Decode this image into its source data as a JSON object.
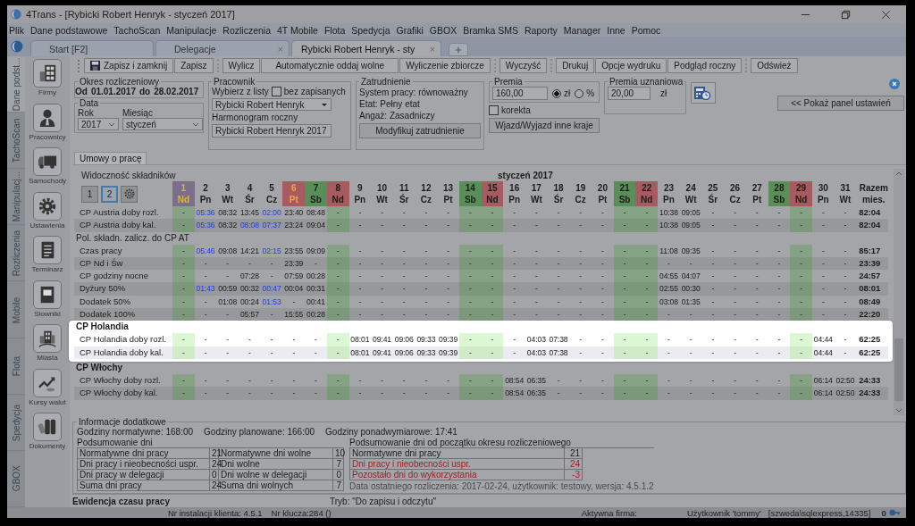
{
  "window": {
    "title": "4Trans - [Rybicki Robert Henryk - styczeń 2017]"
  },
  "menu": [
    "Plik",
    "Dane podstawowe",
    "TachoScan",
    "Manipulacje",
    "Rozliczenia",
    "4T Mobile",
    "Flota",
    "Spedycja",
    "Grafiki",
    "GBOX",
    "Bramka SMS",
    "Raporty",
    "Manager",
    "Inne",
    "Pomoc"
  ],
  "tabs": [
    {
      "label": "Start [F2]",
      "selected": false
    },
    {
      "label": "Delegacje",
      "close": "×",
      "selected": false
    },
    {
      "label": "Rybicki Robert Henryk - sty",
      "close": "×",
      "selected": true
    }
  ],
  "side_tabs": [
    {
      "label": "Dane podst...",
      "selected": true
    },
    {
      "label": "TachoScan",
      "selected": false
    },
    {
      "label": "Manipulacj...",
      "selected": false
    },
    {
      "label": "Rozliczenia",
      "selected": false
    },
    {
      "label": "Mobile",
      "selected": false
    },
    {
      "label": "Flota",
      "selected": false
    },
    {
      "label": "Spedycja",
      "selected": false
    },
    {
      "label": "GBOX",
      "selected": false
    }
  ],
  "sidebar": [
    {
      "label": "Firmy"
    },
    {
      "label": "Pracownicy"
    },
    {
      "label": "Samochody"
    },
    {
      "label": "Ustawienia"
    },
    {
      "label": "Terminarz"
    },
    {
      "label": "Słowniki"
    },
    {
      "label": "Miasta"
    },
    {
      "label": "Kursy walut"
    },
    {
      "label": "Dokumenty"
    }
  ],
  "toolbar": [
    [
      "Zapisz i zamknij",
      "Zapisz"
    ],
    [
      "Wylicz",
      "Automatycznie oddaj wolne",
      "Wyliczenie zbiorcze"
    ],
    [
      "Wyczyść"
    ],
    [
      "Drukuj",
      "Opcje wydruku",
      "Podgląd roczny"
    ],
    [
      "Odśwież"
    ]
  ],
  "period": {
    "title": "Okres rozliczeniowy",
    "from_label": "Od",
    "from": "01.01.2017",
    "to_label": "do",
    "to": "28.02.2017"
  },
  "date": {
    "title": "Data",
    "year_label": "Rok",
    "year": "2017",
    "month_label": "Miesiąc",
    "month": "styczeń"
  },
  "employee": {
    "title": "Pracownik",
    "choose_label": "Wybierz z listy",
    "unsaved_label": "bez zapisanych",
    "unsaved_checked": false,
    "employee": "Rybicki Robert Henryk",
    "schedule_label": "Harmonogram roczny",
    "schedule": "Rybicki Robert Henryk 2017"
  },
  "employment": {
    "title": "Zatrudnienie",
    "lines": [
      "System pracy: równoważny",
      "Etat: Pełny etat",
      "Angaż: Zasadniczy"
    ],
    "button": "Modyfikuj zatrudnienie"
  },
  "bonus": {
    "title": "Premia",
    "value": "160,00",
    "units": [
      {
        "label": "zł",
        "selected": true
      },
      {
        "label": "%",
        "selected": false
      }
    ],
    "correction_label": "korekta",
    "correction_checked": false,
    "button": "Wjazd/Wyjazd inne kraje"
  },
  "discretionary_bonus": {
    "title": "Premia uznaniowa",
    "value": "20,00",
    "unit": "zł"
  },
  "settings_button": "<< Pokaż panel ustawień",
  "content_tabs": [
    {
      "label": "Umowy o pracę",
      "selected": true
    }
  ],
  "grid": {
    "visibility_label": "Widoczność składników",
    "visibility_buttons": [
      {
        "label": "1",
        "selected": false
      },
      {
        "label": "2",
        "selected": true
      }
    ],
    "month": "styczeń 2017",
    "total_label": "Razem mies.",
    "days": [
      {
        "number": "1",
        "weekday": "Nd",
        "kind": "feast_sunday",
        "rest": true
      },
      {
        "number": "2",
        "weekday": "Pn",
        "kind": "workday",
        "rest": false
      },
      {
        "number": "3",
        "weekday": "Wt",
        "kind": "workday",
        "rest": false
      },
      {
        "number": "4",
        "weekday": "Śr",
        "kind": "workday",
        "rest": false
      },
      {
        "number": "5",
        "weekday": "Cz",
        "kind": "workday",
        "rest": false
      },
      {
        "number": "6",
        "weekday": "Pt",
        "kind": "feast",
        "rest": false
      },
      {
        "number": "7",
        "weekday": "Sb",
        "kind": "saturday",
        "rest": false
      },
      {
        "number": "8",
        "weekday": "Nd",
        "kind": "sunday",
        "rest": true
      },
      {
        "number": "9",
        "weekday": "Pn",
        "kind": "workday",
        "rest": false
      },
      {
        "number": "10",
        "weekday": "Wt",
        "kind": "workday",
        "rest": false
      },
      {
        "number": "11",
        "weekday": "Śr",
        "kind": "workday",
        "rest": false
      },
      {
        "number": "12",
        "weekday": "Cz",
        "kind": "workday",
        "rest": false
      },
      {
        "number": "13",
        "weekday": "Pt",
        "kind": "workday",
        "rest": false
      },
      {
        "number": "14",
        "weekday": "Sb",
        "kind": "saturday",
        "rest": true
      },
      {
        "number": "15",
        "weekday": "Nd",
        "kind": "sunday",
        "rest": true
      },
      {
        "number": "16",
        "weekday": "Pn",
        "kind": "workday",
        "rest": false
      },
      {
        "number": "17",
        "weekday": "Wt",
        "kind": "workday",
        "rest": false
      },
      {
        "number": "18",
        "weekday": "Śr",
        "kind": "workday",
        "rest": false
      },
      {
        "number": "19",
        "weekday": "Cz",
        "kind": "workday",
        "rest": false
      },
      {
        "number": "20",
        "weekday": "Pt",
        "kind": "workday",
        "rest": false
      },
      {
        "number": "21",
        "weekday": "Sb",
        "kind": "saturday",
        "rest": true
      },
      {
        "number": "22",
        "weekday": "Nd",
        "kind": "sunday",
        "rest": true
      },
      {
        "number": "23",
        "weekday": "Pn",
        "kind": "workday",
        "rest": false
      },
      {
        "number": "24",
        "weekday": "Wt",
        "kind": "workday",
        "rest": false
      },
      {
        "number": "25",
        "weekday": "Śr",
        "kind": "workday",
        "rest": false
      },
      {
        "number": "26",
        "weekday": "Cz",
        "kind": "workday",
        "rest": false
      },
      {
        "number": "27",
        "weekday": "Pt",
        "kind": "workday",
        "rest": false
      },
      {
        "number": "28",
        "weekday": "Sb",
        "kind": "saturday",
        "rest": false
      },
      {
        "number": "29",
        "weekday": "Nd",
        "kind": "sunday",
        "rest": true
      },
      {
        "number": "30",
        "weekday": "Pn",
        "kind": "workday",
        "rest": false
      },
      {
        "number": "31",
        "weekday": "Wt",
        "kind": "workday",
        "rest": false
      }
    ],
    "groups": [
      {
        "highlighted": false,
        "rows": [
          {
            "label": "CP Austria doby rozl.",
            "blue": [
              false,
              true,
              false,
              false,
              true,
              false,
              false,
              false,
              false,
              false,
              false,
              false,
              false,
              false,
              false,
              false,
              false,
              false,
              false,
              false,
              false,
              false,
              false,
              false,
              false,
              false,
              false,
              false,
              false,
              false,
              false
            ],
            "values": [
              "-",
              "05:36",
              "08:32",
              "13:45",
              "02:00",
              "23:40",
              "08:48",
              "-",
              "-",
              "-",
              "-",
              "-",
              "-",
              "-",
              "-",
              "-",
              "-",
              "-",
              "-",
              "-",
              "-",
              "-",
              "10:38",
              "09:05",
              "-",
              "-",
              "-",
              "-",
              "-",
              "-",
              "-",
              "82:04"
            ]
          },
          {
            "label": "CP Austria doby kal.",
            "blue": [
              false,
              true,
              false,
              true,
              true,
              false,
              false,
              false,
              false,
              false,
              false,
              false,
              false,
              false,
              false,
              false,
              false,
              false,
              false,
              false,
              false,
              false,
              false,
              false,
              false,
              false,
              false,
              false,
              false,
              false,
              false
            ],
            "values": [
              "-",
              "05:36",
              "08:32",
              "08:08",
              "07:37",
              "23:24",
              "09:04",
              "-",
              "-",
              "-",
              "-",
              "-",
              "-",
              "-",
              "-",
              "-",
              "-",
              "-",
              "-",
              "-",
              "-",
              "-",
              "10:38",
              "09:05",
              "-",
              "-",
              "-",
              "-",
              "-",
              "-",
              "-",
              "82:04"
            ]
          }
        ]
      },
      {
        "label": "Pol. składn. zalicz. do CP AT",
        "kind": "note",
        "highlighted": false,
        "rows": [
          {
            "label": "Czas pracy",
            "blue": [
              false,
              true,
              false,
              false,
              true,
              false,
              false,
              false,
              false,
              false,
              false,
              false,
              false,
              false,
              false,
              false,
              false,
              false,
              false,
              false,
              false,
              false,
              false,
              false,
              false,
              false,
              false,
              false,
              false,
              false,
              false
            ],
            "values": [
              "-",
              "05:46",
              "09:08",
              "14:21",
              "02:15",
              "23:55",
              "09:09",
              "-",
              "-",
              "-",
              "-",
              "-",
              "-",
              "-",
              "-",
              "-",
              "-",
              "-",
              "-",
              "-",
              "-",
              "-",
              "11:08",
              "09:35",
              "-",
              "-",
              "-",
              "-",
              "-",
              "-",
              "-",
              "85:17"
            ]
          },
          {
            "label": "CP Nd i Św",
            "values": [
              "-",
              "-",
              "-",
              "-",
              "-",
              "23:39",
              "-",
              "-",
              "-",
              "-",
              "-",
              "-",
              "-",
              "-",
              "-",
              "-",
              "-",
              "-",
              "-",
              "-",
              "-",
              "-",
              "-",
              "-",
              "-",
              "-",
              "-",
              "-",
              "-",
              "-",
              "-",
              "23:39"
            ]
          },
          {
            "label": "CP godziny nocne",
            "values": [
              "-",
              "-",
              "-",
              "07:28",
              "-",
              "07:59",
              "00:28",
              "-",
              "-",
              "-",
              "-",
              "-",
              "-",
              "-",
              "-",
              "-",
              "-",
              "-",
              "-",
              "-",
              "-",
              "-",
              "04:55",
              "04:07",
              "-",
              "-",
              "-",
              "-",
              "-",
              "-",
              "-",
              "24:57"
            ]
          },
          {
            "label": "Dyżury 50%",
            "blue": [
              false,
              true,
              false,
              false,
              true,
              false,
              false,
              false,
              false,
              false,
              false,
              false,
              false,
              false,
              false,
              false,
              false,
              false,
              false,
              false,
              false,
              false,
              false,
              false,
              false,
              false,
              false,
              false,
              false,
              false,
              false
            ],
            "values": [
              "-",
              "01:43",
              "00:59",
              "00:32",
              "00:47",
              "00:04",
              "00:31",
              "-",
              "-",
              "-",
              "-",
              "-",
              "-",
              "-",
              "-",
              "-",
              "-",
              "-",
              "-",
              "-",
              "-",
              "-",
              "02:55",
              "00:30",
              "-",
              "-",
              "-",
              "-",
              "-",
              "-",
              "-",
              "08:01"
            ]
          },
          {
            "label": "Dodatek 50%",
            "blue": [
              false,
              false,
              false,
              false,
              true,
              false,
              false,
              false,
              false,
              false,
              false,
              false,
              false,
              false,
              false,
              false,
              false,
              false,
              false,
              false,
              false,
              false,
              false,
              false,
              false,
              false,
              false,
              false,
              false,
              false,
              false
            ],
            "values": [
              "-",
              "-",
              "01:08",
              "00:24",
              "01:53",
              "-",
              "00:41",
              "-",
              "-",
              "-",
              "-",
              "-",
              "-",
              "-",
              "-",
              "-",
              "-",
              "-",
              "-",
              "-",
              "-",
              "-",
              "03:08",
              "01:35",
              "-",
              "-",
              "-",
              "-",
              "-",
              "-",
              "-",
              "08:49"
            ]
          },
          {
            "label": "Dodatek 100%",
            "values": [
              "-",
              "-",
              "-",
              "05:57",
              "-",
              "15:55",
              "00:28",
              "-",
              "-",
              "-",
              "-",
              "-",
              "-",
              "-",
              "-",
              "-",
              "-",
              "-",
              "-",
              "-",
              "-",
              "-",
              "-",
              "-",
              "-",
              "-",
              "-",
              "-",
              "-",
              "-",
              "-",
              "22:20"
            ]
          }
        ]
      },
      {
        "label": "CP Holandia",
        "kind": "section",
        "highlighted": true,
        "rows": [
          {
            "label": "CP Holandia doby rozl.",
            "values": [
              "-",
              "-",
              "-",
              "-",
              "-",
              "-",
              "-",
              "-",
              "08:01",
              "09:41",
              "09:06",
              "09:33",
              "09:39",
              "-",
              "-",
              "-",
              "04:03",
              "07:38",
              "-",
              "-",
              "-",
              "-",
              "-",
              "-",
              "-",
              "-",
              "-",
              "-",
              "-",
              "04:44",
              "-",
              "62:25"
            ]
          },
          {
            "label": "CP Holandia doby kal.",
            "values": [
              "-",
              "-",
              "-",
              "-",
              "-",
              "-",
              "-",
              "-",
              "08:01",
              "09:41",
              "09:06",
              "09:33",
              "09:39",
              "-",
              "-",
              "-",
              "04:03",
              "07:38",
              "-",
              "-",
              "-",
              "-",
              "-",
              "-",
              "-",
              "-",
              "-",
              "-",
              "-",
              "04:44",
              "-",
              "62:25"
            ]
          }
        ]
      },
      {
        "label": "CP Włochy",
        "kind": "section",
        "highlighted": false,
        "rows": [
          {
            "label": "CP Włochy doby rozl.",
            "values": [
              "-",
              "-",
              "-",
              "-",
              "-",
              "-",
              "-",
              "-",
              "-",
              "-",
              "-",
              "-",
              "-",
              "-",
              "-",
              "08:54",
              "06:35",
              "-",
              "-",
              "-",
              "-",
              "-",
              "-",
              "-",
              "-",
              "-",
              "-",
              "-",
              "-",
              "06:14",
              "02:50",
              "24:33"
            ]
          },
          {
            "label": "CP Włochy doby kal.",
            "values": [
              "-",
              "-",
              "-",
              "-",
              "-",
              "-",
              "-",
              "-",
              "-",
              "-",
              "-",
              "-",
              "-",
              "-",
              "-",
              "08:54",
              "06:35",
              "-",
              "-",
              "-",
              "-",
              "-",
              "-",
              "-",
              "-",
              "-",
              "-",
              "-",
              "-",
              "06:14",
              "02:50",
              "24:33"
            ]
          }
        ]
      }
    ]
  },
  "info": {
    "title": "Informacje dodatkowe",
    "hours": [
      "Godziny normatywne: 168:00",
      "Godziny planowane: 166:00",
      "Godziny ponadwymiarowe: 17:41"
    ],
    "days_title": "Podsumowanie dni",
    "days_rows": [
      {
        "l1": "Normatywne dni pracy",
        "v1": "21",
        "l2": "Normatywne dni wolne",
        "v2": "10"
      },
      {
        "l1": "Dni pracy i nieobecności uspr.",
        "v1": "24",
        "l2": "Dni wolne",
        "v2": "7"
      },
      {
        "l1": "Dni pracy w delegacji",
        "v1": "0",
        "l2": "Dni wolne w delegacji",
        "v2": "0"
      },
      {
        "l1": "Suma dni pracy",
        "v1": "24",
        "l2": "Suma dni wolnych",
        "v2": "7"
      }
    ],
    "period_title": "Podsumowanie dni od początku okresu rozliczeniowego",
    "period_rows": [
      {
        "label": "Normatywne dni pracy",
        "value": "21",
        "alert": false
      },
      {
        "label": "Dni pracy i nieobecności uspr.",
        "value": "24",
        "alert": true
      },
      {
        "label": "Pozostało dni do wykorzystania",
        "value": "-3",
        "alert": true
      }
    ],
    "last_settlement": "Data ostatniego rozliczenia: 2017-02-24, użytkownik: testowy, wersja: 4.5.1.2"
  },
  "footer": {
    "module": "Ewidencja czasu pracy",
    "mode": "Tryb: \"Do zapisu i odczytu\""
  },
  "status_bar": {
    "installation": "Nr instalacji klienta: 4.5.1",
    "key": "Nr klucza:284 ()",
    "company": "Aktywna firma:",
    "user": "Użytkownik 'tommy'",
    "server": "[szweda\\sqlexpress,14335]",
    "count": "0"
  }
}
